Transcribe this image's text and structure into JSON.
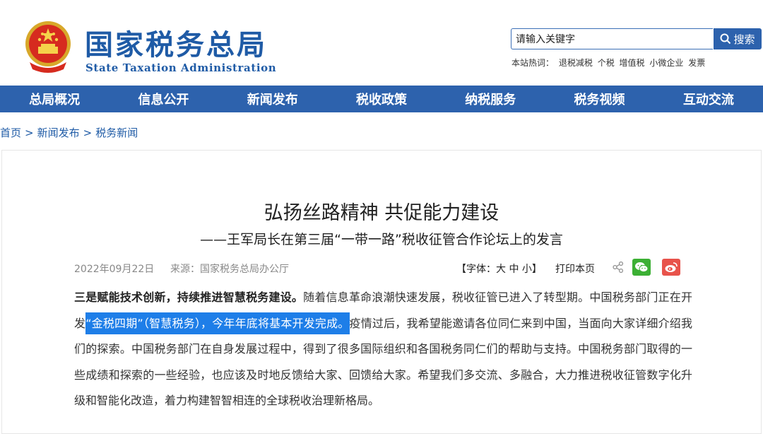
{
  "site": {
    "name_cn": "国家税务总局",
    "name_en": "State Taxation Administration"
  },
  "search": {
    "value": "请输入关键字",
    "button_label": "搜索",
    "hot_label": "本站热词：",
    "hot_words": [
      "退税减税",
      "个税",
      "增值税",
      "小微企业",
      "发票"
    ]
  },
  "nav": {
    "items": [
      "总局概况",
      "信息公开",
      "新闻发布",
      "税收政策",
      "纳税服务",
      "税务视频",
      "互动交流"
    ]
  },
  "breadcrumb": {
    "items": [
      "首页",
      "新闻发布",
      "税务新闻"
    ],
    "separator": ">"
  },
  "article": {
    "title": "弘扬丝路精神 共促能力建设",
    "subtitle": "——王军局长在第三届“一带一路”税收征管合作论坛上的发言",
    "date": "2022年09月22日",
    "source": "来源：国家税务总局办公厅",
    "font_size_label": "【字体：",
    "font_large": "大",
    "font_medium": "中",
    "font_small": "小",
    "font_size_end": "】",
    "print_label": "打印本页",
    "body": {
      "bold_lead": "三是赋能技术创新，持续推进智慧税务建设。",
      "text_before_highlight": "随着信息革命浪潮快速发展，税收征管已进入了转型期。中国税务部门正在开发",
      "highlighted": "“金税四期”（智慧税务），今年年底将基本开发完成。",
      "text_after_highlight": "疫情过后，我希望能邀请各位同仁来到中国，当面向大家详细介绍我们的探索。中国税务部门在自身发展过程中，得到了很多国际组织和各国税务同仁们的帮助与支持。中国税务部门取得的一些成绩和探索的一些经验，也应该及时地反馈给大家、回馈给大家。希望我们多交流、多融合，大力推进税收征管数字化升级和智能化改造，着力构建智智相连的全球税收治理新格局。"
    }
  },
  "colors": {
    "brand_blue": "#2d62ad",
    "highlight": "#1e7ee8",
    "wechat": "#3cb034",
    "weibo": "#e8534b"
  },
  "icons": [
    "national-emblem-icon",
    "search-icon",
    "share-icon",
    "wechat-icon",
    "weibo-icon"
  ]
}
